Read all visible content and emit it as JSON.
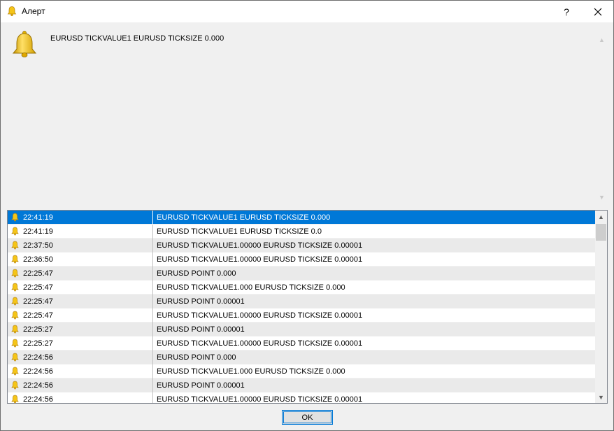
{
  "window": {
    "title": "Алерт",
    "help_label": "?",
    "close_label": "✕"
  },
  "alert": {
    "message": "EURUSD TICKVALUE1 EURUSD TICKSIZE 0.000",
    "icon": "bell-icon"
  },
  "history": {
    "rows": [
      {
        "time": "22:41:19",
        "message": "EURUSD TICKVALUE1 EURUSD TICKSIZE 0.000",
        "selected": true
      },
      {
        "time": "22:41:19",
        "message": "EURUSD TICKVALUE1 EURUSD TICKSIZE 0.0"
      },
      {
        "time": "22:37:50",
        "message": "EURUSD TICKVALUE1.00000 EURUSD TICKSIZE 0.00001"
      },
      {
        "time": "22:36:50",
        "message": "EURUSD TICKVALUE1.00000 EURUSD TICKSIZE 0.00001"
      },
      {
        "time": "22:25:47",
        "message": "EURUSD POINT 0.000"
      },
      {
        "time": "22:25:47",
        "message": "EURUSD TICKVALUE1.000 EURUSD TICKSIZE 0.000"
      },
      {
        "time": "22:25:47",
        "message": "EURUSD POINT 0.00001"
      },
      {
        "time": "22:25:47",
        "message": "EURUSD TICKVALUE1.00000 EURUSD TICKSIZE 0.00001"
      },
      {
        "time": "22:25:27",
        "message": "EURUSD POINT 0.00001"
      },
      {
        "time": "22:25:27",
        "message": "EURUSD TICKVALUE1.00000 EURUSD TICKSIZE 0.00001"
      },
      {
        "time": "22:24:56",
        "message": "EURUSD POINT 0.000"
      },
      {
        "time": "22:24:56",
        "message": "EURUSD TICKVALUE1.000 EURUSD TICKSIZE 0.000"
      },
      {
        "time": "22:24:56",
        "message": "EURUSD POINT 0.00001"
      },
      {
        "time": "22:24:56",
        "message": "EURUSD TICKVALUE1.00000 EURUSD TICKSIZE 0.00001"
      }
    ]
  },
  "buttons": {
    "ok_label": "OK"
  },
  "colors": {
    "selection": "#0078d7",
    "bell": "#f2c200"
  }
}
